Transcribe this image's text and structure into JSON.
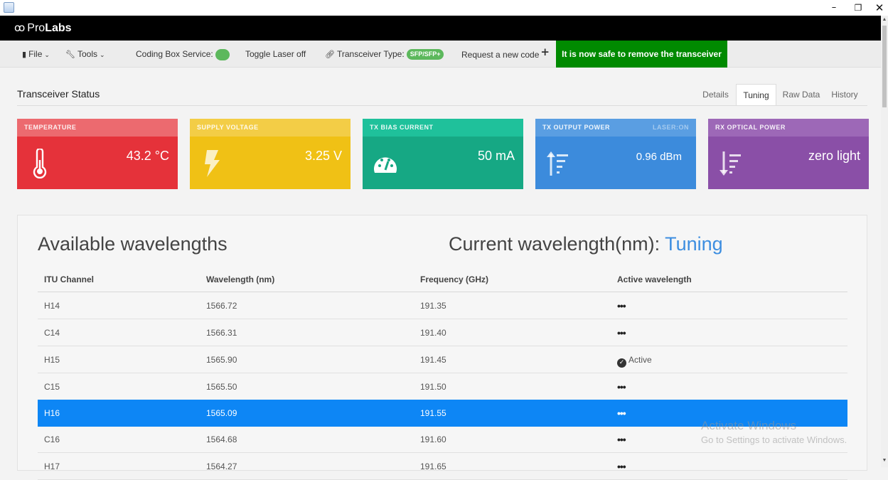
{
  "window": {
    "minimize": "–",
    "maximize": "❐",
    "close": "✕"
  },
  "brand": {
    "prefix": "Pro",
    "bold": "Labs"
  },
  "toolbar": {
    "file": "File",
    "tools": "Tools",
    "coding_box": "Coding Box Service:",
    "coding_box_status_color": "#5cb85c",
    "toggle_laser": "Toggle Laser off",
    "transceiver_type_label": "Transceiver Type:",
    "transceiver_type_value": "SFP/SFP+",
    "request_code": "Request a new code",
    "safe_banner": "It is now safe to remove the transceiver"
  },
  "section": {
    "title": "Transceiver Status",
    "tabs": [
      "Details",
      "Tuning",
      "Raw Data",
      "History"
    ],
    "active_tab": "Tuning"
  },
  "cards": {
    "temperature": {
      "label": "Temperature",
      "value": "43.2 °C",
      "color": "#e5323a",
      "icon": "thermometer-icon"
    },
    "voltage": {
      "label": "Supply Voltage",
      "value": "3.25 V",
      "color": "#f0c115",
      "icon": "bolt-icon"
    },
    "bias": {
      "label": "TX Bias Current",
      "value": "50 mA",
      "color": "#16a884",
      "icon": "gauge-icon"
    },
    "tx_power": {
      "label": "TX Output Power",
      "extra": "LASER:ON",
      "value": "0.96 dBm",
      "color": "#3c8bdc",
      "icon": "sort-up-icon"
    },
    "rx_power": {
      "label": "RX Optical Power",
      "value": "zero light",
      "color": "#8a4fa7",
      "icon": "sort-down-icon"
    }
  },
  "wavelengths": {
    "title": "Available wavelengths",
    "current_label": "Current wavelength(nm):",
    "current_value": "Tuning",
    "columns": [
      "ITU Channel",
      "Wavelength (nm)",
      "Frequency (GHz)",
      "Active wavelength"
    ],
    "rows": [
      {
        "channel": "H14",
        "wavelength": "1566.72",
        "frequency": "191.35",
        "active": "•••"
      },
      {
        "channel": "C14",
        "wavelength": "1566.31",
        "frequency": "191.40",
        "active": "•••"
      },
      {
        "channel": "H15",
        "wavelength": "1565.90",
        "frequency": "191.45",
        "active": "Active"
      },
      {
        "channel": "C15",
        "wavelength": "1565.50",
        "frequency": "191.50",
        "active": "•••"
      },
      {
        "channel": "H16",
        "wavelength": "1565.09",
        "frequency": "191.55",
        "active": "•••"
      },
      {
        "channel": "C16",
        "wavelength": "1564.68",
        "frequency": "191.60",
        "active": "•••"
      },
      {
        "channel": "H17",
        "wavelength": "1564.27",
        "frequency": "191.65",
        "active": "•••"
      }
    ],
    "selected_channel": "H16"
  },
  "watermark": {
    "line1": "Activate Windows",
    "line2": "Go to Settings to activate Windows."
  }
}
